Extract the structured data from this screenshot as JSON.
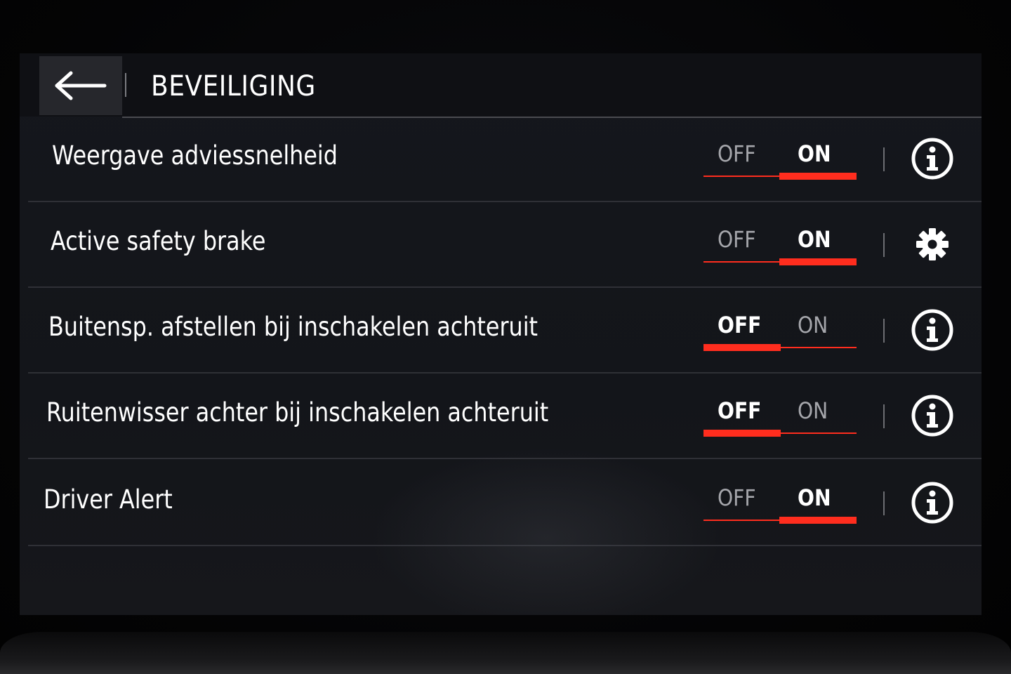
{
  "header": {
    "title": "BEVEILIGING",
    "back_icon": "back-arrow-icon"
  },
  "accent_color": "#ff2d1e",
  "settings": [
    {
      "label": "Weergave adviessnelheid",
      "off_label": "OFF",
      "on_label": "ON",
      "state": "ON",
      "action_icon": "info-icon"
    },
    {
      "label": "Active safety brake",
      "off_label": "OFF",
      "on_label": "ON",
      "state": "ON",
      "action_icon": "gear-icon"
    },
    {
      "label": "Buitensp. afstellen bij inschakelen achteruit",
      "off_label": "OFF",
      "on_label": "ON",
      "state": "OFF",
      "action_icon": "info-icon"
    },
    {
      "label": "Ruitenwisser achter bij inschakelen achteruit",
      "off_label": "OFF",
      "on_label": "ON",
      "state": "OFF",
      "action_icon": "info-icon"
    },
    {
      "label": "Driver Alert",
      "off_label": "OFF",
      "on_label": "ON",
      "state": "ON",
      "action_icon": "info-icon"
    }
  ]
}
